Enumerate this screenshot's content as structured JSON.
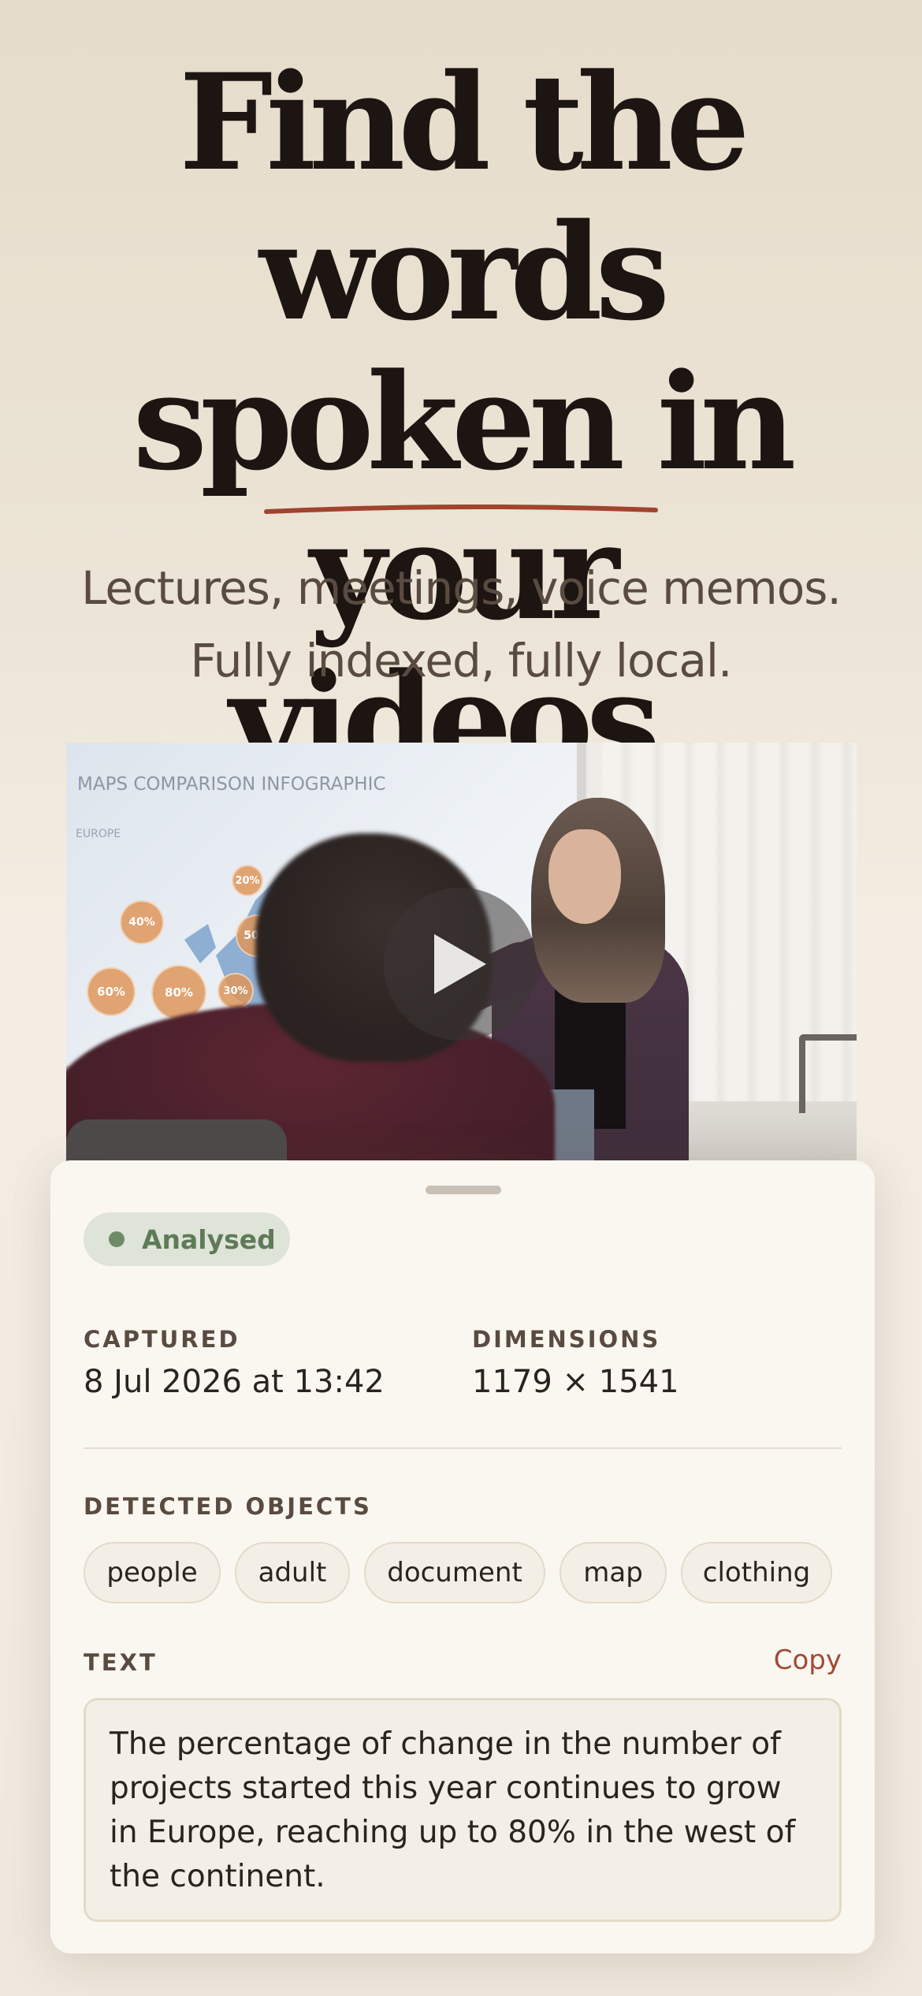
{
  "hero": {
    "title_line1": "Find the words",
    "title_line2": "spoken in your",
    "title_line3": "videos.",
    "subtitle_line1": "Lectures, meetings, voice memos.",
    "subtitle_line2": "Fully indexed, fully local.",
    "underline_color": "#a0432f"
  },
  "video": {
    "screen_title": "MAPS COMPARISON INFOGRAPHIC",
    "screen_sub": "EUROPE",
    "bubbles": [
      "20%",
      "40%",
      "50%",
      "60%",
      "80%",
      "30%"
    ]
  },
  "card": {
    "status": "Analysed",
    "status_color": "#6f8a67",
    "captured_label": "CAPTURED",
    "captured_value": "8 Jul 2026 at 13:42",
    "dimensions_label": "DIMENSIONS",
    "dimensions_value": "1179 × 1541",
    "objects_label": "DETECTED OBJECTS",
    "objects": [
      "people",
      "adult",
      "document",
      "map",
      "clothing"
    ],
    "text_label": "TEXT",
    "copy_label": "Copy",
    "text_value": "The percentage of change in the number of projects started this year continues to grow in Europe, reaching up to 80% in the west of the continent."
  }
}
